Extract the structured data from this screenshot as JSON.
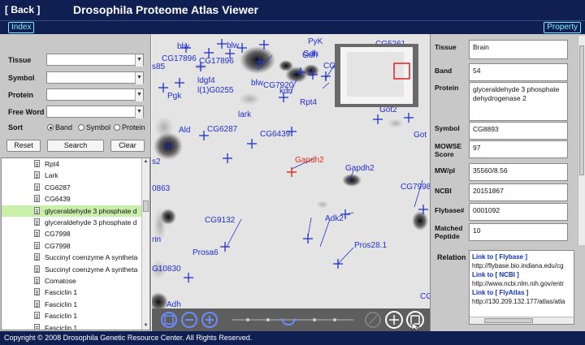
{
  "header": {
    "back_label": "[ Back ]",
    "title": "Drosophila Proteome Atlas Viewer",
    "index_label": "Index",
    "property_label": "Property"
  },
  "search": {
    "tissue_label": "Tissue",
    "symbol_label": "Symbol",
    "protein_label": "Protein",
    "free_word_label": "Free Word",
    "sort_label": "Sort",
    "sort_options": [
      "Band",
      "Symbol",
      "Protein"
    ],
    "sort_selected": "Band",
    "reset_label": "Reset",
    "search_label": "Search",
    "clear_label": "Clear"
  },
  "list": {
    "items": [
      "Rpt4",
      "Lark",
      "CG6287",
      "CG6439",
      "glyceraldehyde 3 phosphate d",
      "glyceraldehyde 3 phosphate d",
      "CG7998",
      "CG7998",
      "Succinyl coenzyme A syntheta",
      "Succinyl coenzyme A syntheta",
      "Comatose",
      "Fasciclin 1",
      "Fasciclin 1",
      "Fasciclin 1",
      "Fasciclin 1"
    ],
    "selected_index": 4
  },
  "gel": {
    "labels": [
      "blw",
      "blw",
      "CG17896",
      "CG17896",
      "Gdh",
      "PyK",
      "Gdh",
      "CG74",
      "CG5261",
      "ldgf4",
      "l(1)G0255",
      "blw",
      "CG7920",
      "kdn",
      "Pgk",
      "Rpt4",
      "kdn",
      "Got2",
      "Got",
      "lark",
      "Ald",
      "CG6287",
      "CG6439",
      "Gapdh2",
      "Gapdh2",
      "CG7998",
      "0863",
      "CG9132",
      "Adk2",
      "Pros28.1",
      "Prosa6",
      "G10830",
      "Adh",
      "CG",
      "Locator",
      "rin",
      "s2",
      "s85"
    ],
    "highlight_label": "Gapdh2",
    "highlight_color": "#e03020",
    "marker_color": "#1f2fd0"
  },
  "toolbar": {
    "icons": [
      "fit-icon",
      "zoom-out-icon",
      "zoom-in-icon",
      "swap-icon",
      "move-icon",
      "locator-icon"
    ]
  },
  "protein": {
    "tissue_label": "Tissue",
    "tissue": "Brain",
    "band_label": "Band",
    "band": "54",
    "protein_label": "Protein",
    "protein": "glyceraldehyde 3 phosphate dehydrogenase 2",
    "symbol_label": "Symbol",
    "symbol": "CG8893",
    "mowse_label": "MOWSE Score",
    "mowse": "97",
    "mwpi_label": "MW/pI",
    "mwpi": "35560/8.56",
    "ncbi_label": "NCBI",
    "ncbi": "20151867",
    "flybase_label": "Flybase#",
    "flybase": "0001092",
    "matched_label": "Matched Peptide",
    "matched": "10",
    "relation_label": "Relation",
    "links": [
      {
        "label": "Link to [ Flybase ]",
        "url": "http://flybase.bio.indiana.edu/cg"
      },
      {
        "label": "Link to [ NCBI ]",
        "url": "http://www.ncbi.nlm.nih.gov/entr"
      },
      {
        "label": "Link to [ FlyAtlas ]",
        "url": "http://130.209.132.177/atlas/atla"
      }
    ]
  },
  "footer": {
    "copyright": "Copyright © 2008 Drosophila Genetic Resource Center. All Rights Reserved."
  }
}
